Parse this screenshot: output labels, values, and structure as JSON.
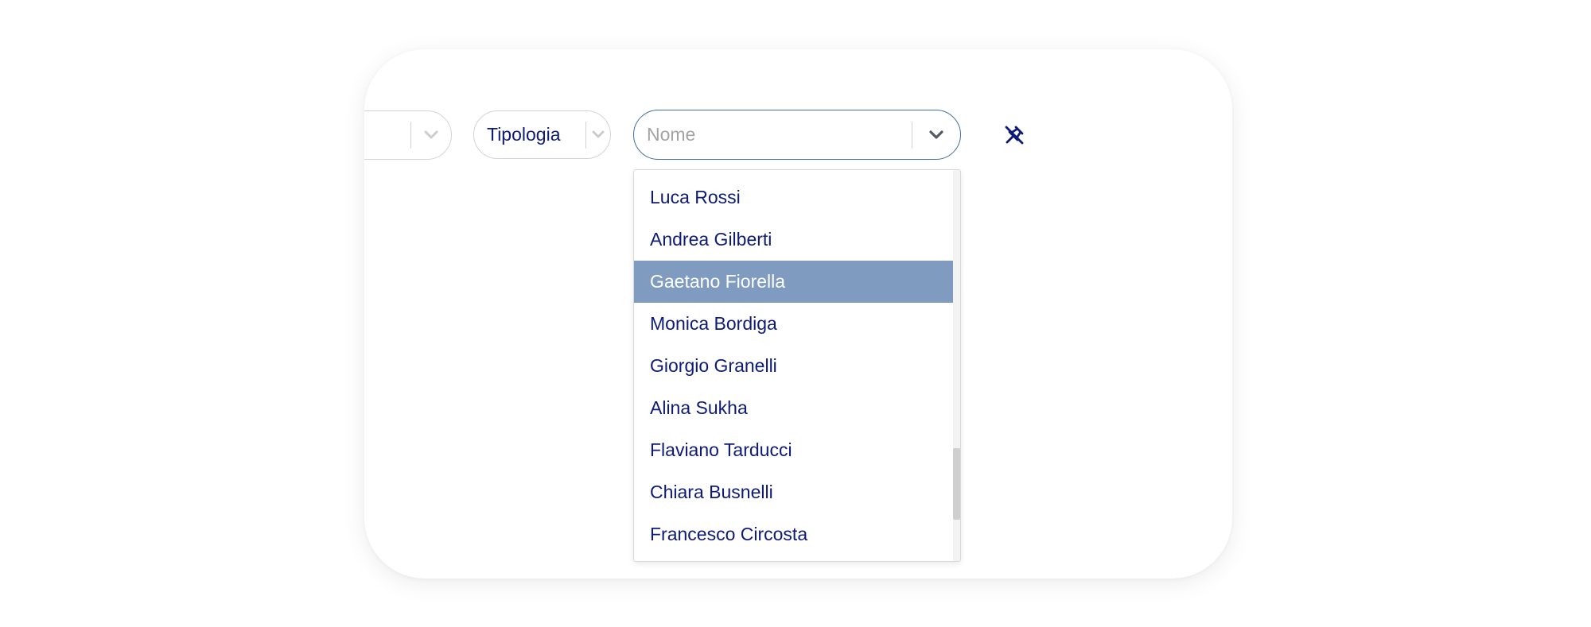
{
  "filters": {
    "tipologia_label": "Tipologia",
    "nome_placeholder": "Nome",
    "nome_value": ""
  },
  "icons": {
    "chevron": "chevron-down-icon",
    "unpin": "unpin-icon"
  },
  "colors": {
    "text": "#0d1a7a",
    "selected_bg": "#7f9cc0",
    "focus_border": "#3f6d99"
  },
  "dropdown": {
    "selected_index": 2,
    "options": [
      "Luca Rossi",
      "Andrea Gilberti",
      "Gaetano Fiorella",
      "Monica Bordiga",
      "Giorgio Granelli",
      "Alina Sukha",
      "Flaviano Tarducci",
      "Chiara Busnelli",
      "Francesco Circosta"
    ]
  }
}
